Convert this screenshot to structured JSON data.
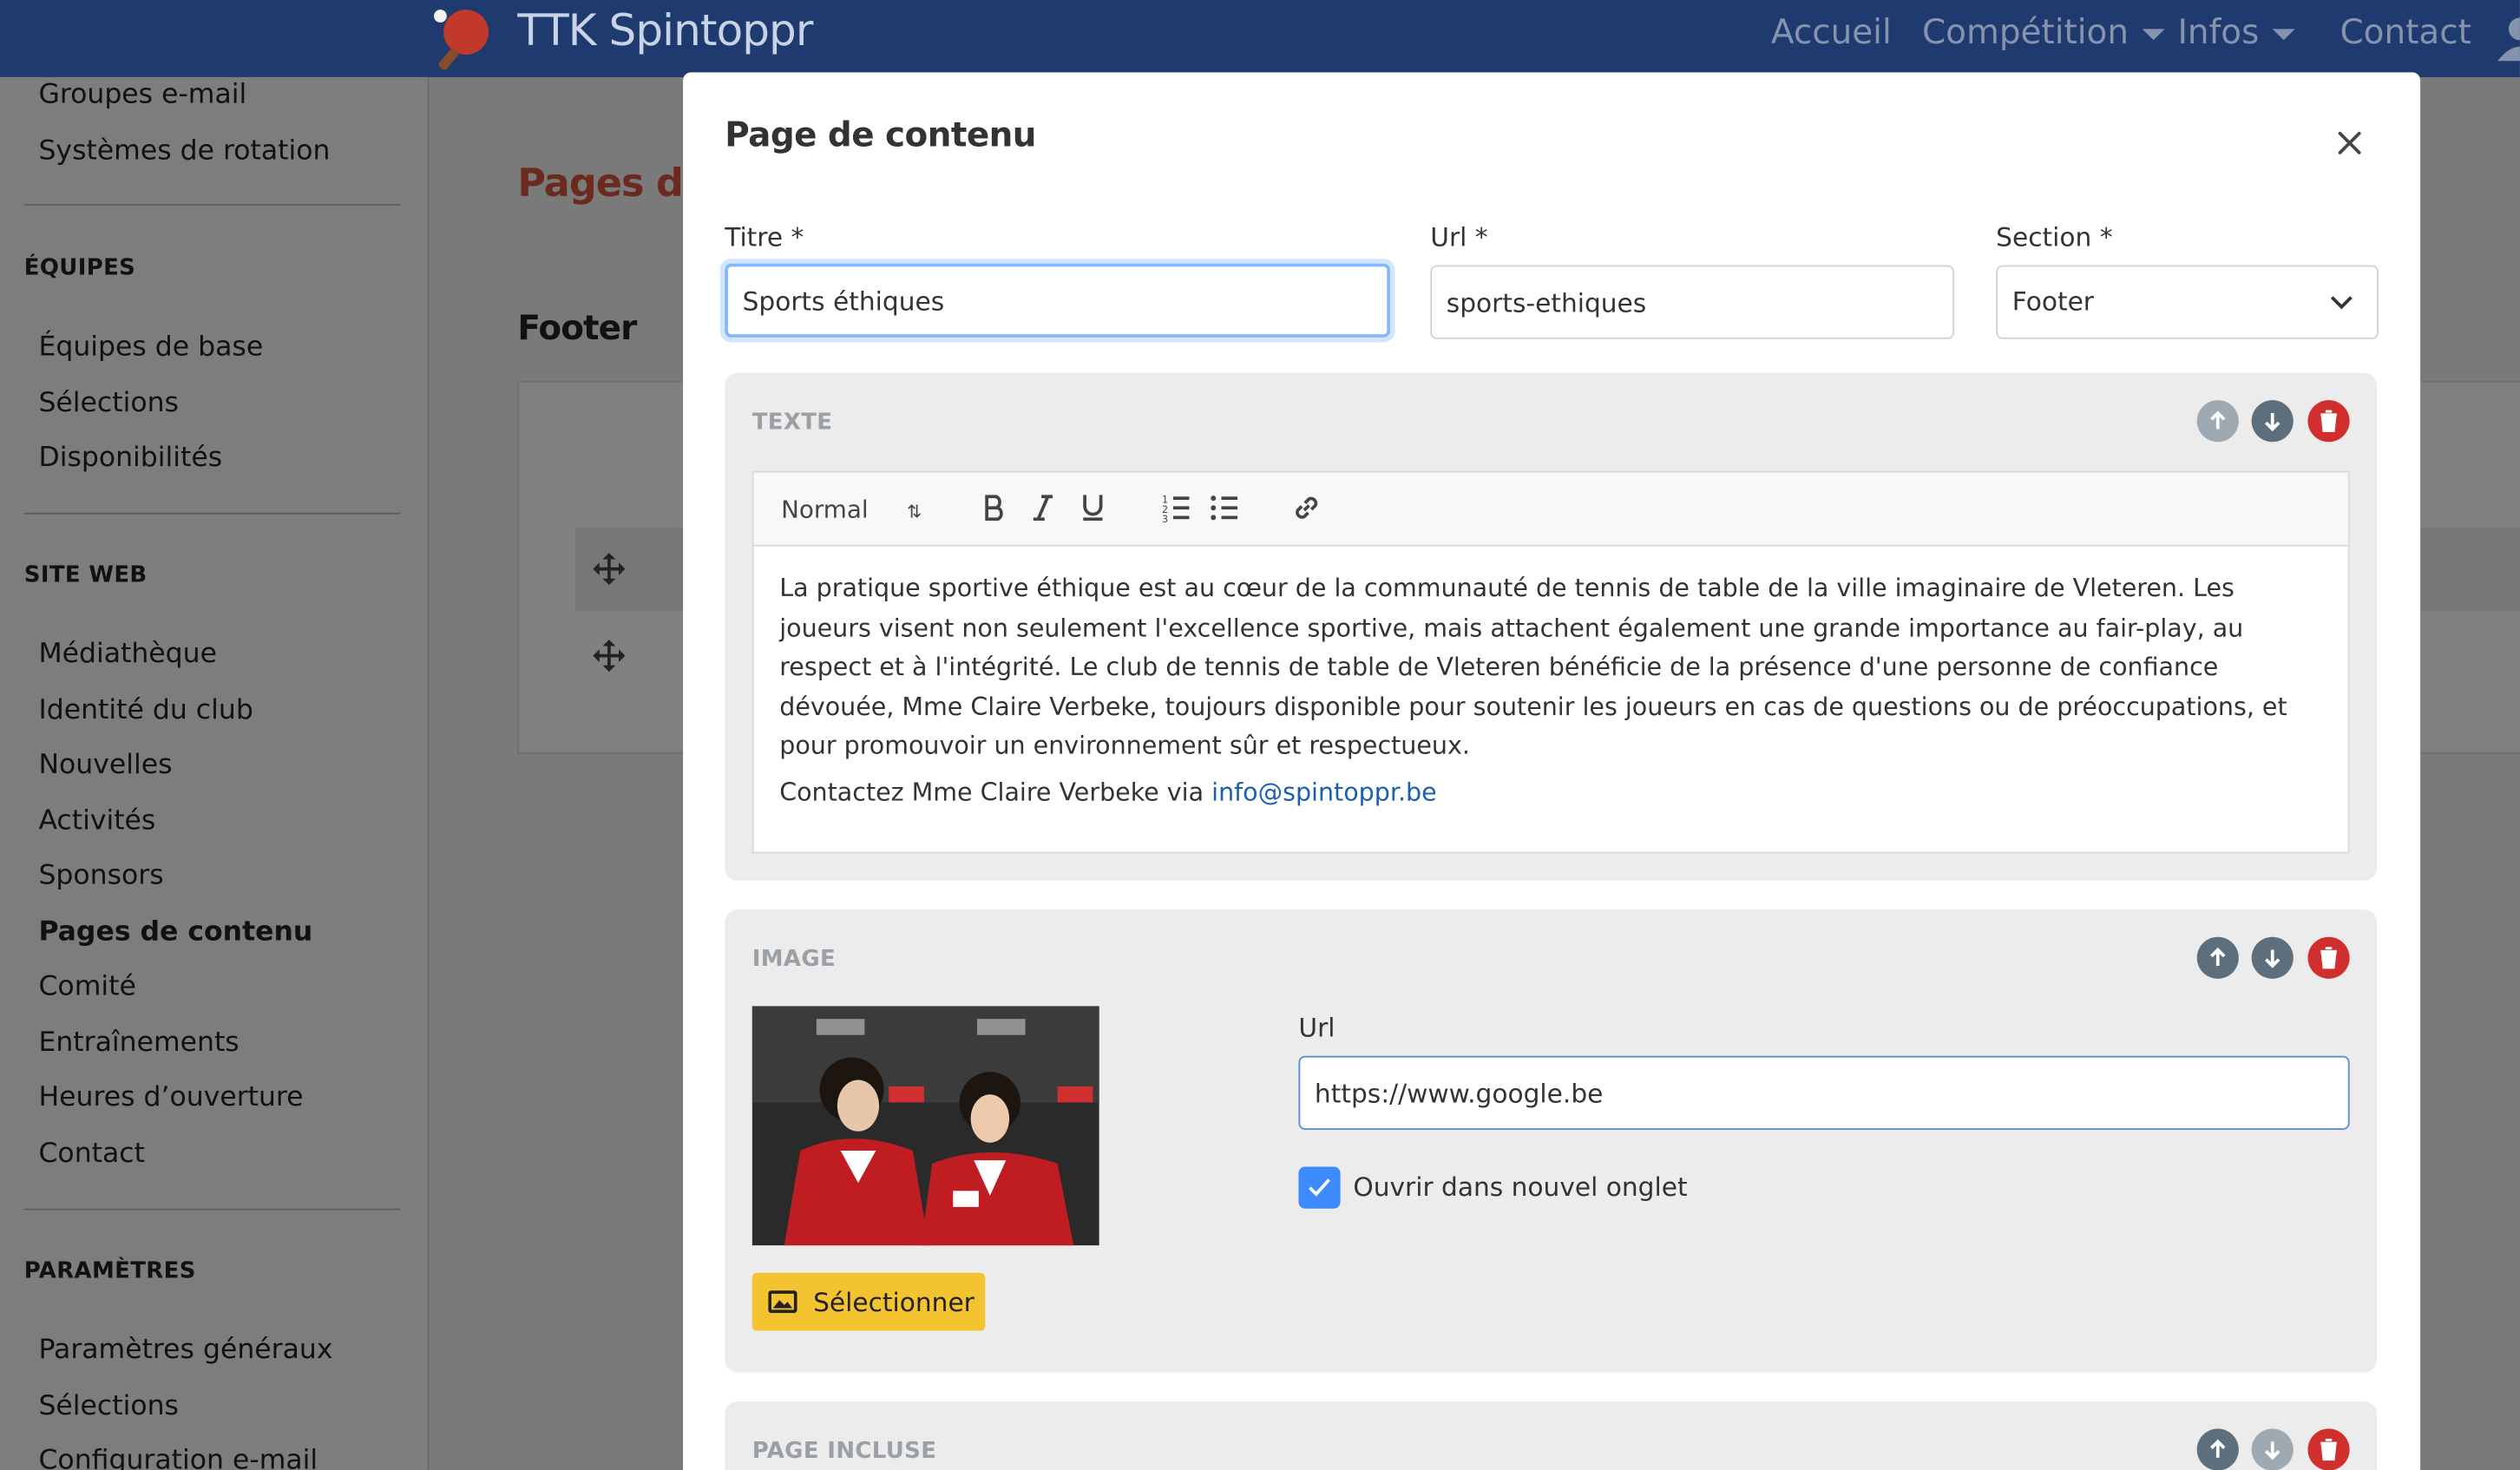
{
  "navbar": {
    "brand": "TTK Spintoppr",
    "links": [
      {
        "label": "Accueil"
      },
      {
        "label": "Compétition"
      },
      {
        "label": "Infos"
      },
      {
        "label": "Contact"
      }
    ]
  },
  "sidebar": {
    "items_top": [
      "Groupes e-mail",
      "Systèmes de rotation"
    ],
    "section_equipes": "ÉQUIPES",
    "equipes": [
      "Équipes de base",
      "Sélections",
      "Disponibilités"
    ],
    "section_site": "SITE WEB",
    "site": [
      "Médiathèque",
      "Identité du club",
      "Nouvelles",
      "Activités",
      "Sponsors",
      "Pages de contenu",
      "Comité",
      "Entraînements",
      "Heures d’ouverture",
      "Contact"
    ],
    "section_params": "PARAMÈTRES",
    "params": [
      "Paramètres généraux",
      "Sélections",
      "Configuration e-mail"
    ]
  },
  "background": {
    "title": "Pages de co",
    "footer_label": "Footer"
  },
  "modal": {
    "title": "Page de contenu",
    "fields": {
      "titre_label": "Titre *",
      "titre_value": "Sports éthiques",
      "url_label": "Url *",
      "url_value": "sports-ethiques",
      "section_label": "Section *",
      "section_value": "Footer"
    },
    "text_block": {
      "title": "TEXTE",
      "format": "Normal",
      "paragraph": "La pratique sportive éthique est au cœur de la communauté de tennis de table de la ville imaginaire de Vleteren. Les joueurs visent non seulement l'excellence sportive, mais attachent également une grande importance au fair-play, au respect et à l'intégrité. Le club de tennis de table de Vleteren bénéficie de la présence d'une personne de confiance dévouée, Mme Claire Verbeke, toujours disponible pour soutenir les joueurs en cas de questions ou de préoccupations, et pour promouvoir un environnement sûr et respectueux.",
      "contact_prefix": "Contactez Mme Claire Verbeke via",
      "contact_email": "info@spintoppr.be"
    },
    "image_block": {
      "title": "IMAGE",
      "url_label": "Url",
      "url_value": "https://www.google.be",
      "checkbox_label": "Ouvrir dans nouvel onglet",
      "checkbox_checked": true,
      "select_label": "Sélectionner"
    },
    "included_block": {
      "title": "PAGE INCLUSE"
    }
  },
  "colors": {
    "navbar": "#1f3a6e",
    "accent_yellow": "#f4c430",
    "danger": "#d12e2e",
    "checkbox": "#3d8bfd"
  }
}
